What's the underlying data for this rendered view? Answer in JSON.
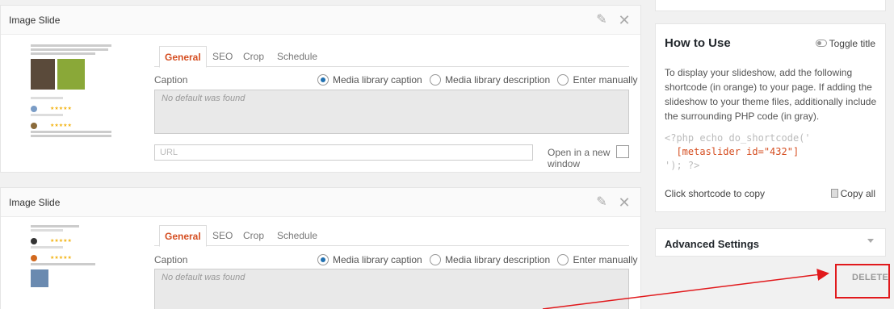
{
  "slides": [
    {
      "title": "Image Slide",
      "tabs": [
        "General",
        "SEO",
        "Crop",
        "Schedule"
      ],
      "caption_label": "Caption",
      "radio_options": [
        "Media library caption",
        "Media library description",
        "Enter manually"
      ],
      "selected_option": "Media library caption",
      "caption_placeholder": "No default was found",
      "url_placeholder": "URL",
      "new_window_label": "Open in a new window"
    },
    {
      "title": "Image Slide",
      "tabs": [
        "General",
        "SEO",
        "Crop",
        "Schedule"
      ],
      "caption_label": "Caption",
      "radio_options": [
        "Media library caption",
        "Media library description",
        "Enter manually"
      ],
      "selected_option": "Media library caption",
      "caption_placeholder": "No default was found"
    }
  ],
  "sidebar": {
    "howto": {
      "title": "How to Use",
      "toggle_label": "Toggle title",
      "description": "To display your slideshow, add the following shortcode (in orange) to your page. If adding the slideshow to your theme files, additionally include the surrounding PHP code (in gray).",
      "code_open": "<?php echo do_shortcode('",
      "shortcode": "[metaslider id=\"432\"]",
      "code_close": "'); ?>",
      "copy_hint": "Click shortcode to copy",
      "copy_all_label": "Copy all"
    },
    "advanced": {
      "title": "Advanced Settings"
    },
    "delete_label": "DELETE"
  },
  "colors": {
    "accent": "#d54e21",
    "annotation_red": "#e1191c",
    "radio_checked": "#2271b1"
  },
  "icons": [
    "pencil-icon",
    "close-icon",
    "toggle-icon",
    "copy-icon",
    "chevron-down-icon"
  ]
}
